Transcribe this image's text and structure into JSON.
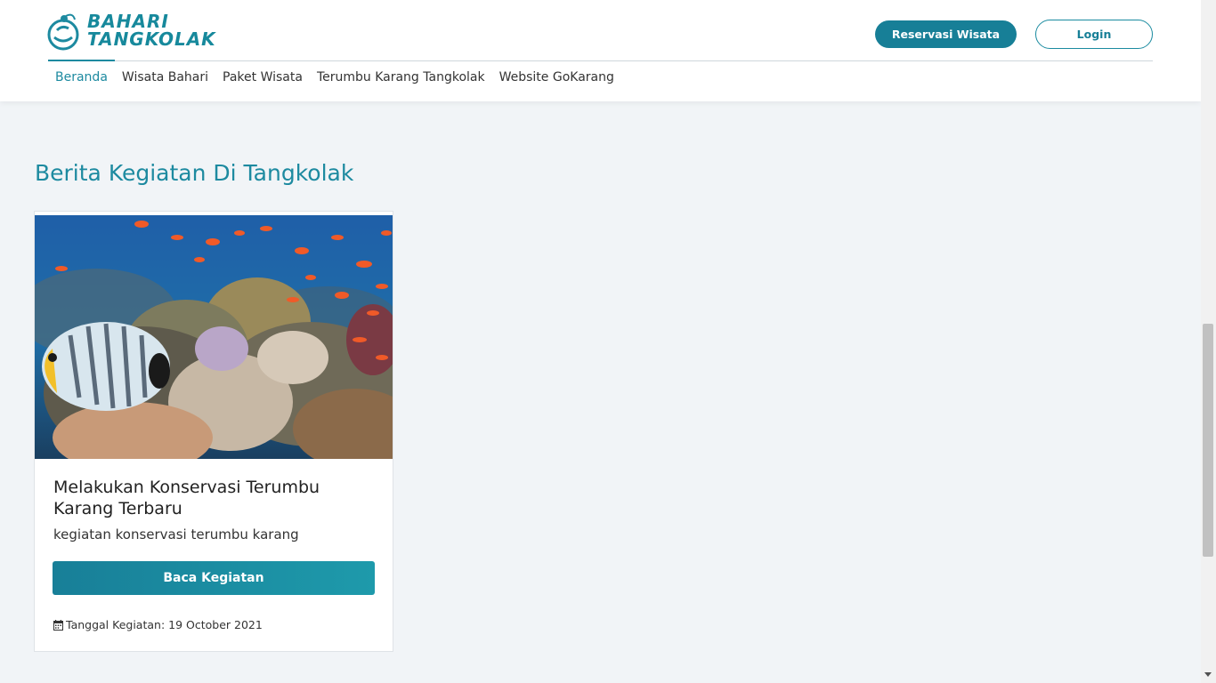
{
  "header": {
    "logo_line1": "BAHARI",
    "logo_line2": "TANGKOLAK",
    "reservasi_label": "Reservasi Wisata",
    "login_label": "Login",
    "nav": [
      {
        "label": "Beranda"
      },
      {
        "label": "Wisata Bahari"
      },
      {
        "label": "Paket Wisata"
      },
      {
        "label": "Terumbu Karang Tangkolak"
      },
      {
        "label": "Website GoKarang"
      }
    ],
    "active_nav": "Beranda"
  },
  "section": {
    "title": "Berita Kegiatan Di Tangkolak"
  },
  "card": {
    "title": "Melakukan Konservasi Terumbu Karang Terbaru",
    "description": "kegiatan konservasi terumbu karang",
    "button_label": "Baca Kegiatan",
    "date_text": "Tanggal Kegiatan: 19 October 2021",
    "date_icon": "calendar-icon",
    "image": "coral-reef-photo"
  },
  "colors": {
    "brand": "#1d8aa0",
    "button_dark": "#177f97",
    "page_background": "#f1f4f7"
  }
}
